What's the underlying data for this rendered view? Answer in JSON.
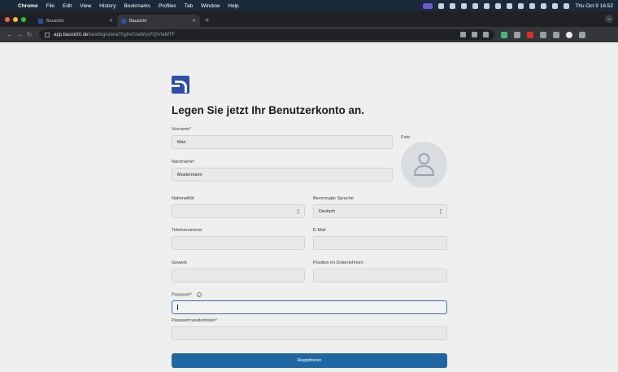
{
  "menubar": {
    "app": "Chrome",
    "items": [
      "File",
      "Edit",
      "View",
      "History",
      "Bookmarks",
      "Profiles",
      "Tab",
      "Window",
      "Help"
    ],
    "clock": "Thu Oct 9  16:52"
  },
  "browser": {
    "tabs": [
      {
        "title": "Bausicht",
        "active": false
      },
      {
        "title": "Bausicht",
        "active": true
      }
    ],
    "url_host": "app.bausicht.de",
    "url_path": "/landing/site/aThghvGraWyxPQlVtaMTF"
  },
  "form": {
    "title": "Legen Sie jetzt Ihr Benutzerkonto an.",
    "photo_label": "Foto",
    "vorname": {
      "label": "Vorname*",
      "value": "Max"
    },
    "nachname": {
      "label": "Nachname*",
      "value": "Mustermann"
    },
    "nationalitaet": {
      "label": "Nationalität",
      "value": ""
    },
    "sprache": {
      "label": "Bevorzugte Sprache",
      "value": "Deutsch"
    },
    "telefon": {
      "label": "Telefonnummer",
      "value": ""
    },
    "email": {
      "label": "E-Mail",
      "value": ""
    },
    "gewerk": {
      "label": "Gewerk",
      "value": ""
    },
    "position": {
      "label": "Position im Unternehmen",
      "value": ""
    },
    "passwort": {
      "label": "Passwort*",
      "value": ""
    },
    "passwort2": {
      "label": "Passwort wiederholen*",
      "value": ""
    },
    "submit_label": "Registrieren"
  },
  "colors": {
    "brand": "#2d4fa8",
    "button": "#1f67a3",
    "focus": "#3a6fb0"
  }
}
